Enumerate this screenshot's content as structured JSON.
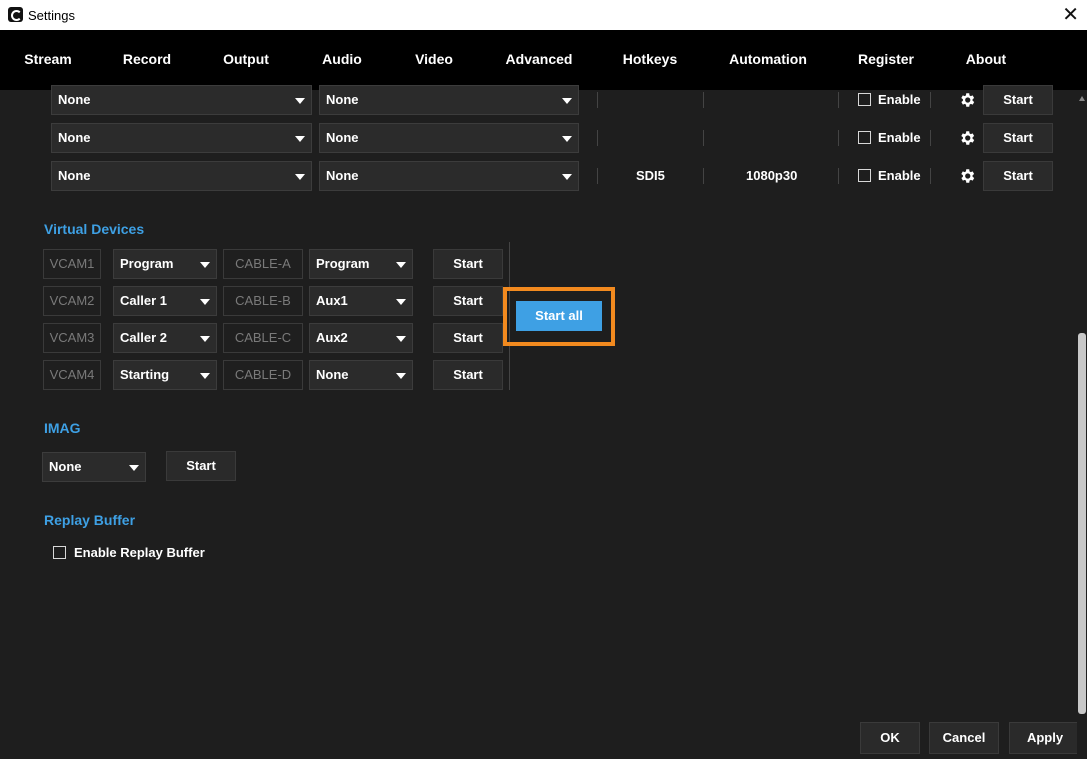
{
  "window": {
    "title": "Settings",
    "close_glyph": "✕"
  },
  "tabs": [
    {
      "label": "Stream"
    },
    {
      "label": "Record"
    },
    {
      "label": "Output",
      "active": true
    },
    {
      "label": "Audio"
    },
    {
      "label": "Video"
    },
    {
      "label": "Advanced"
    },
    {
      "label": "Hotkeys"
    },
    {
      "label": "Automation"
    },
    {
      "label": "Register"
    },
    {
      "label": "About"
    }
  ],
  "output_rows": [
    {
      "source": "None",
      "target": "None",
      "device": "",
      "format": "",
      "enable_label": "Enable",
      "enabled": false,
      "start_label": "Start"
    },
    {
      "source": "None",
      "target": "None",
      "device": "",
      "format": "",
      "enable_label": "Enable",
      "enabled": false,
      "start_label": "Start"
    },
    {
      "source": "None",
      "target": "None",
      "device": "SDI5",
      "format": "1080p30",
      "enable_label": "Enable",
      "enabled": false,
      "start_label": "Start"
    }
  ],
  "virtual_devices": {
    "title": "Virtual Devices",
    "rows": [
      {
        "vcam": "VCAM1",
        "source": "Program",
        "cable": "CABLE-A",
        "output": "Program",
        "start_label": "Start"
      },
      {
        "vcam": "VCAM2",
        "source": "Caller 1",
        "cable": "CABLE-B",
        "output": "Aux1",
        "start_label": "Start"
      },
      {
        "vcam": "VCAM3",
        "source": "Caller 2",
        "cable": "CABLE-C",
        "output": "Aux2",
        "start_label": "Start"
      },
      {
        "vcam": "VCAM4",
        "source": "Starting",
        "cable": "CABLE-D",
        "output": "None",
        "start_label": "Start"
      }
    ],
    "start_all_label": "Start all"
  },
  "imag": {
    "title": "IMAG",
    "source": "None",
    "start_label": "Start"
  },
  "replay_buffer": {
    "title": "Replay Buffer",
    "checkbox_label": "Enable Replay Buffer",
    "enabled": false
  },
  "footer": {
    "ok_label": "OK",
    "cancel_label": "Cancel",
    "apply_label": "Apply"
  },
  "colors": {
    "accent": "#3ea0e4",
    "highlight": "#f28a1f",
    "background": "#1e1e1e",
    "tabbar": "#000000"
  }
}
